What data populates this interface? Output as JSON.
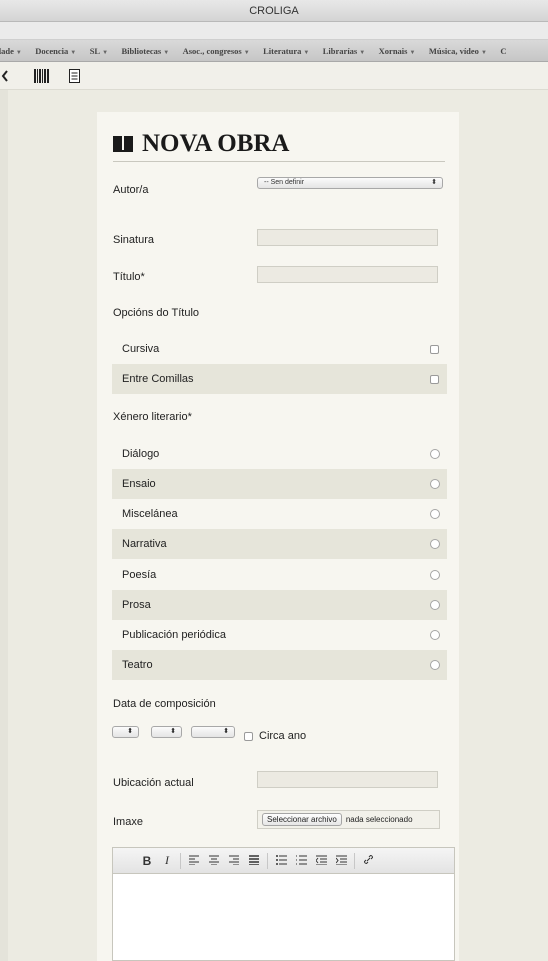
{
  "window": {
    "title": "CROLIGA"
  },
  "nav": {
    "items": [
      "idade",
      "Docencia",
      "SL",
      "Bibliotecas",
      "Asoc., congresos",
      "Literatura",
      "Librarías",
      "Xornais",
      "Música, vídeo",
      "C"
    ],
    "caret": "▼"
  },
  "toolbar": {
    "icons": [
      "back-arrow-icon",
      "barcode-icon",
      "document-icon"
    ]
  },
  "form": {
    "title": "NOVA OBRA",
    "autor": {
      "label": "Autor/a",
      "value": "-- Sen definir"
    },
    "sinatura": {
      "label": "Sinatura",
      "value": ""
    },
    "titulo": {
      "label": "Título*",
      "value": ""
    },
    "opcions_titulo": {
      "label": "Opcións do Título",
      "options": [
        "Cursiva",
        "Entre Comillas"
      ]
    },
    "xenero": {
      "label": "Xénero literario*",
      "options": [
        "Diálogo",
        "Ensaio",
        "Miscelánea",
        "Narrativa",
        "Poesía",
        "Prosa",
        "Publicación periódica",
        "Teatro"
      ]
    },
    "data_composicion": {
      "label": "Data de composición",
      "circa_label": "Circa ano"
    },
    "ubicacion": {
      "label": "Ubicación actual",
      "value": ""
    },
    "imaxe": {
      "label": "Imaxe",
      "button_label": "Seleccionar archivo",
      "status": "nada seleccionado"
    },
    "editor": {
      "bold": "B",
      "italic": "I"
    }
  },
  "colors": {
    "background": "#ecebe2",
    "panel": "#f7f6f0",
    "row_alt": "#e6e5da"
  }
}
